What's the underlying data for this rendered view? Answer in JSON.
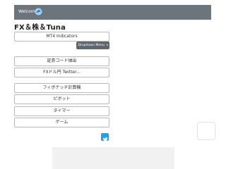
{
  "header": {
    "welcome_text": "Welcome!",
    "welcome_icon": "dolphin-icon"
  },
  "app": {
    "title": "FX＆株＆Tuna"
  },
  "buttons": {
    "mt4": "MT4 Indicators",
    "dropdown": "Dropdown Menu",
    "stock_code": "証券コード抽出",
    "fx_twitter": "FXドル円 Twitter...",
    "fibonacci": "フィボナッチ計算機",
    "pivot": "ピボット",
    "timer": "タイマー",
    "game": "ゲーム"
  },
  "icons": {
    "twitter": "twitter-icon",
    "dropdown_caret": "caret-down-icon"
  },
  "colors": {
    "topbar": "#6c747c",
    "dropdown": "#5e666e",
    "twitter": "#1da1f2"
  }
}
